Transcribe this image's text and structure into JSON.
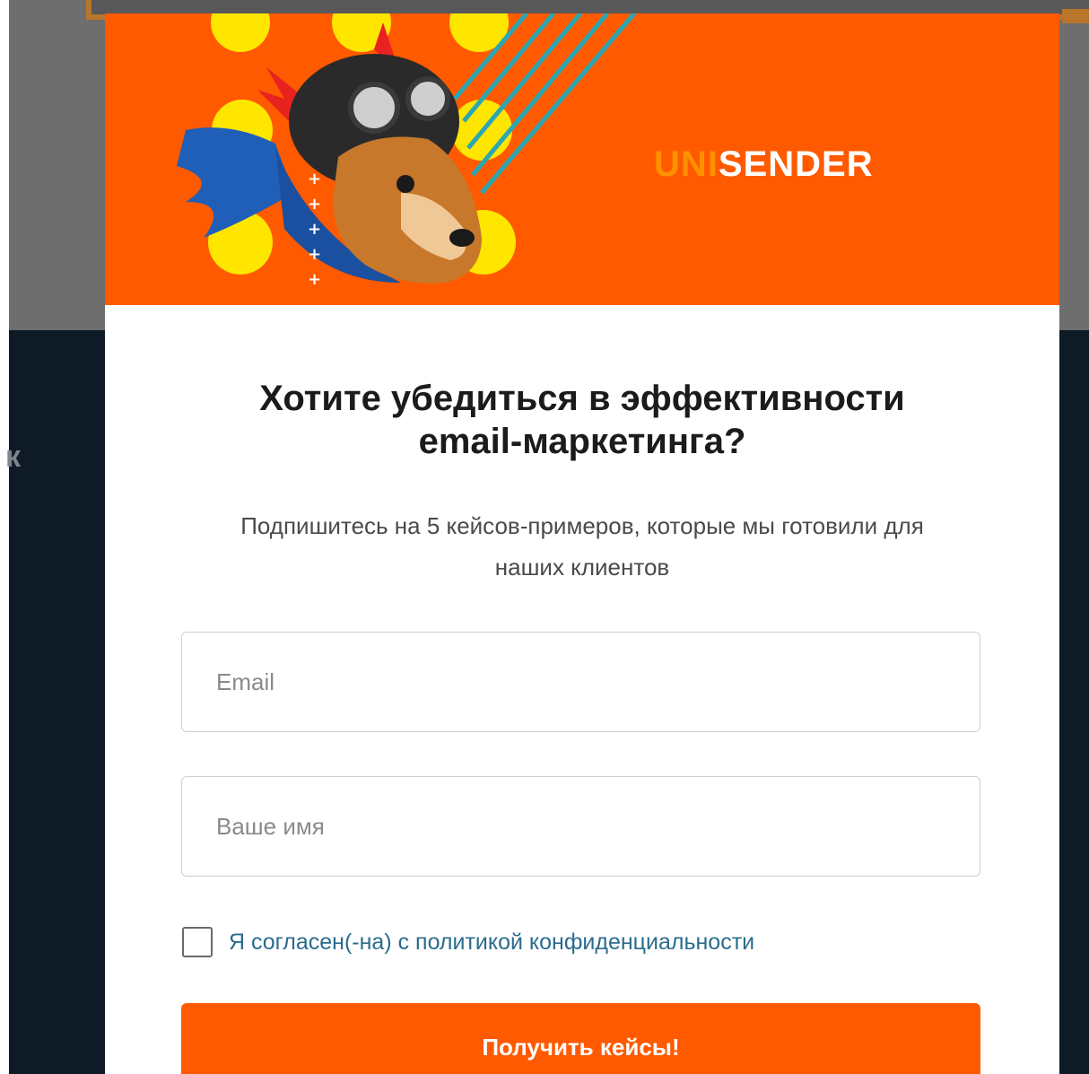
{
  "background": {
    "partial_label": "к"
  },
  "modal": {
    "logo": {
      "part1": "UNI",
      "part2": "SENDER"
    },
    "title_line1": "Хотите убедиться в эффективности",
    "title_line2": "email-маркетинга?",
    "subtitle_line1": "Подпишитесь на 5 кейсов-примеров, которые мы готовили для",
    "subtitle_line2": "наших клиентов",
    "fields": {
      "email_placeholder": "Email",
      "email_value": "",
      "name_placeholder": "Ваше имя",
      "name_value": ""
    },
    "consent": {
      "label": "Я согласен(-на) с политикой конфиденциальности",
      "checked": false
    },
    "submit_label": "Получить кейсы!"
  },
  "colors": {
    "brand_orange": "#ff5a00",
    "logo_accent": "#ff9100",
    "link_blue": "#2b6c8e",
    "dark_background": "#0e1b27"
  },
  "icons": [
    "dog-aviator-mascot-illustration"
  ]
}
